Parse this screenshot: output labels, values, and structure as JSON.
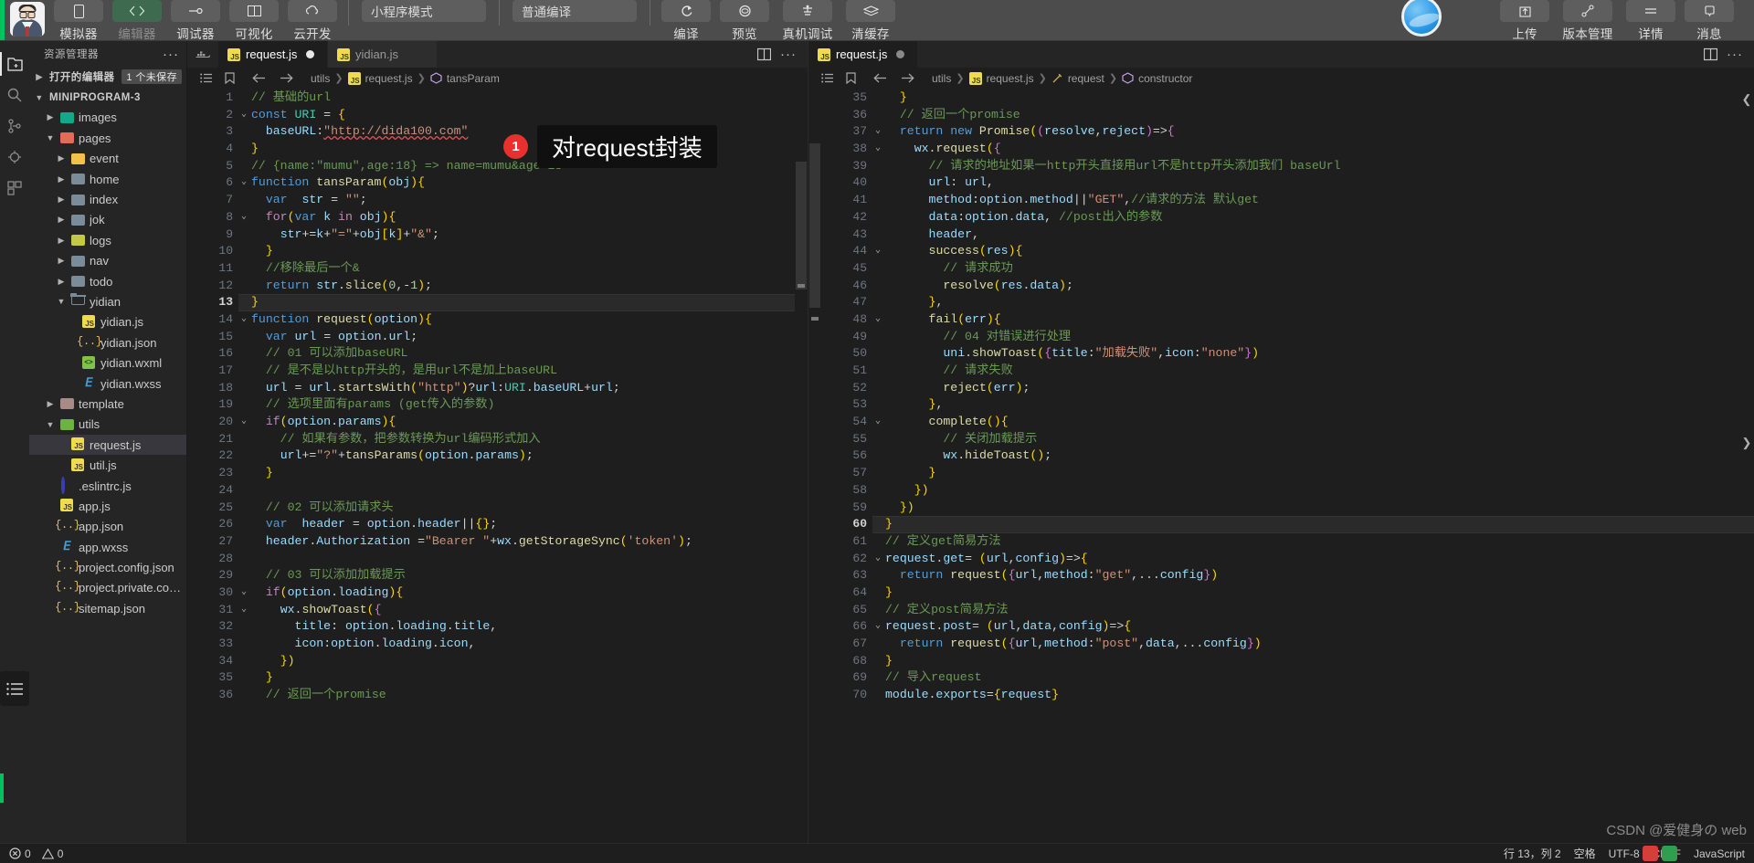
{
  "topbar": {
    "tools": [
      {
        "label": "模拟器",
        "icon": "phone-icon",
        "active": false
      },
      {
        "label": "编辑器",
        "icon": "code-icon",
        "active": true,
        "dim": true
      },
      {
        "label": "调试器",
        "icon": "bug-icon",
        "active": false
      },
      {
        "label": "可视化",
        "icon": "panels-icon",
        "active": false
      },
      {
        "label": "云开发",
        "icon": "cloud-icon",
        "active": false
      }
    ],
    "mode_select": "小程序模式",
    "compile_select": "普通编译",
    "actions": [
      "编译",
      "预览",
      "真机调试",
      "清缓存"
    ],
    "right_tools": [
      {
        "label": "上传",
        "icon": "upload-icon"
      },
      {
        "label": "版本管理",
        "icon": "branch-icon"
      },
      {
        "label": "详情",
        "icon": "details-icon"
      },
      {
        "label": "消息",
        "icon": "message-icon"
      }
    ],
    "avatar": "user-avatar"
  },
  "activity": {
    "items": [
      {
        "icon": "explorer-icon",
        "active": true
      },
      {
        "icon": "search-icon",
        "active": false
      },
      {
        "icon": "source-control-icon",
        "active": false
      },
      {
        "icon": "debug-icon",
        "active": false
      },
      {
        "icon": "extensions-icon",
        "active": false
      }
    ],
    "bottom": [
      {
        "icon": "list-icon"
      }
    ]
  },
  "explorer": {
    "title": "资源管理器",
    "more": "···",
    "open_editors": {
      "label": "打开的编辑器",
      "badge": "1 个未保存"
    },
    "project": "MINIPROGRAM-3",
    "tree": [
      {
        "label": "images",
        "indent": 1,
        "kind": "folder",
        "color": "teal",
        "state": "collapsed"
      },
      {
        "label": "pages",
        "indent": 1,
        "kind": "folder",
        "color": "red",
        "state": "expanded"
      },
      {
        "label": "event",
        "indent": 2,
        "kind": "folder",
        "color": "yellow",
        "state": "collapsed"
      },
      {
        "label": "home",
        "indent": 2,
        "kind": "folder",
        "color": "blue",
        "state": "collapsed"
      },
      {
        "label": "index",
        "indent": 2,
        "kind": "folder",
        "color": "blue",
        "state": "collapsed"
      },
      {
        "label": "jok",
        "indent": 2,
        "kind": "folder",
        "color": "blue",
        "state": "collapsed"
      },
      {
        "label": "logs",
        "indent": 2,
        "kind": "folder",
        "color": "olive",
        "state": "collapsed"
      },
      {
        "label": "nav",
        "indent": 2,
        "kind": "folder",
        "color": "blue",
        "state": "collapsed"
      },
      {
        "label": "todo",
        "indent": 2,
        "kind": "folder",
        "color": "blue",
        "state": "collapsed"
      },
      {
        "label": "yidian",
        "indent": 2,
        "kind": "folder-open",
        "color": "blue",
        "state": "expanded"
      },
      {
        "label": "yidian.js",
        "indent": 3,
        "kind": "js"
      },
      {
        "label": "yidian.json",
        "indent": 3,
        "kind": "json"
      },
      {
        "label": "yidian.wxml",
        "indent": 3,
        "kind": "wxml"
      },
      {
        "label": "yidian.wxss",
        "indent": 3,
        "kind": "wxss"
      },
      {
        "label": "template",
        "indent": 1,
        "kind": "folder",
        "color": "rose",
        "state": "collapsed"
      },
      {
        "label": "utils",
        "indent": 1,
        "kind": "folder",
        "color": "green",
        "state": "expanded"
      },
      {
        "label": "request.js",
        "indent": 2,
        "kind": "js",
        "selected": true
      },
      {
        "label": "util.js",
        "indent": 2,
        "kind": "js"
      },
      {
        "label": ".eslintrc.js",
        "indent": 1,
        "kind": "eslint"
      },
      {
        "label": "app.js",
        "indent": 1,
        "kind": "js"
      },
      {
        "label": "app.json",
        "indent": 1,
        "kind": "json"
      },
      {
        "label": "app.wxss",
        "indent": 1,
        "kind": "wxss"
      },
      {
        "label": "project.config.json",
        "indent": 1,
        "kind": "json"
      },
      {
        "label": "project.private.config.json",
        "indent": 1,
        "kind": "json"
      },
      {
        "label": "sitemap.json",
        "indent": 1,
        "kind": "json"
      }
    ]
  },
  "callout": {
    "number": "1",
    "text": "对request封装"
  },
  "left_pane": {
    "tabs": [
      {
        "label": "request.js",
        "icon": "js-icon",
        "active": true,
        "dirty": true
      },
      {
        "label": "yidian.js",
        "icon": "js-icon",
        "active": false,
        "dirty": false
      }
    ],
    "tab_actions": [
      "split-editor-icon",
      "more-actions-icon"
    ],
    "breadcrumb": [
      "utils",
      "request.js",
      "tansParam"
    ],
    "breadcrumb_icons": [
      "outline-icon",
      "bookmark-icon",
      "back-arrow-icon",
      "forward-arrow-icon"
    ],
    "first_line": 1,
    "current_line": 13,
    "lines": [
      "// 基础的url",
      "const URI = {",
      "  baseURL:\"http://dida100.com\"",
      "}",
      "// {name:\"mumu\",age:18} => name=mumu&age=18",
      "function tansParam(obj){",
      "  var  str = \"\";",
      "  for(var k in obj){",
      "    str+=k+\"=\"+obj[k]+\"&\";",
      "  }",
      "  //移除最后一个&",
      "  return str.slice(0,-1);",
      "}",
      "function request(option){",
      "  var url = option.url;",
      "  // 01 可以添加baseURL",
      "  // 是不是以http开头的，是用url不是加上baseURL",
      "  url = url.startsWith(\"http\")?url:URI.baseURL+url;",
      "  // 选项里面有params (get传入的参数)",
      "  if(option.params){",
      "    // 如果有参数，把参数转换为url编码形式加入",
      "    url+=\"?\"+tansParams(option.params);",
      "  }",
      "",
      "  // 02 可以添加请求头",
      "  var  header = option.header||{};",
      "  header.Authorization =\"Bearer \"+wx.getStorageSync('token');",
      "",
      "  // 03 可以添加加载提示",
      "  if(option.loading){",
      "    wx.showToast({",
      "      title: option.loading.title,",
      "      icon:option.loading.icon,",
      "    })",
      "  }",
      "  // 返回一个promise"
    ],
    "fold_lines": [
      2,
      6,
      8,
      14,
      20,
      30,
      31
    ]
  },
  "right_pane": {
    "tabs": [
      {
        "label": "request.js",
        "icon": "js-icon",
        "active": true,
        "dirty": true
      }
    ],
    "tab_actions": [
      "split-editor-icon",
      "more-actions-icon"
    ],
    "breadcrumb": [
      "utils",
      "request.js",
      "request",
      "constructor"
    ],
    "first_line": 35,
    "current_line": 60,
    "lines": [
      "  }",
      "  // 返回一个promise",
      "  return new Promise((resolve,reject)=>{",
      "    wx.request({",
      "      // 请求的地址如果一http开头直接用url不是http开头添加我们 baseUrl",
      "      url: url,",
      "      method:option.method||\"GET\",//请求的方法 默认get",
      "      data:option.data, //post出入的参数",
      "      header,",
      "      success(res){",
      "        // 请求成功",
      "        resolve(res.data);",
      "      },",
      "      fail(err){",
      "        // 04 对错误进行处理",
      "        uni.showToast({title:\"加载失败\",icon:\"none\"})",
      "        // 请求失败",
      "        reject(err);",
      "      },",
      "      complete(){",
      "        // 关闭加载提示",
      "        wx.hideToast();",
      "      }",
      "    })",
      "  })",
      "}",
      "// 定义get简易方法",
      "request.get= (url,config)=>{",
      "  return request({url,method:\"get\",...config})",
      "}",
      "// 定义post简易方法",
      "request.post= (url,data,config)=>{",
      "  return request({url,method:\"post\",data,...config})",
      "}",
      "// 导入request",
      "module.exports={request}"
    ],
    "fold_lines": [
      37,
      38,
      44,
      48,
      54,
      62,
      66
    ]
  },
  "statusbar": {
    "errors": "0",
    "warnings": "0",
    "position": "行 13，列 2",
    "spaces": "空格",
    "encoding": "UTF-8",
    "eol": "CRLF",
    "language": "JavaScript"
  },
  "watermark": {
    "text": "CSDN @爱健身の web"
  },
  "colors": {
    "accent_green": "#00c25e",
    "callout_red": "#e8302e",
    "selection": "#37373d",
    "editor_bg": "#1e1e1e",
    "sidebar_bg": "#252526",
    "toolbar_bg": "#4c4c4c"
  }
}
